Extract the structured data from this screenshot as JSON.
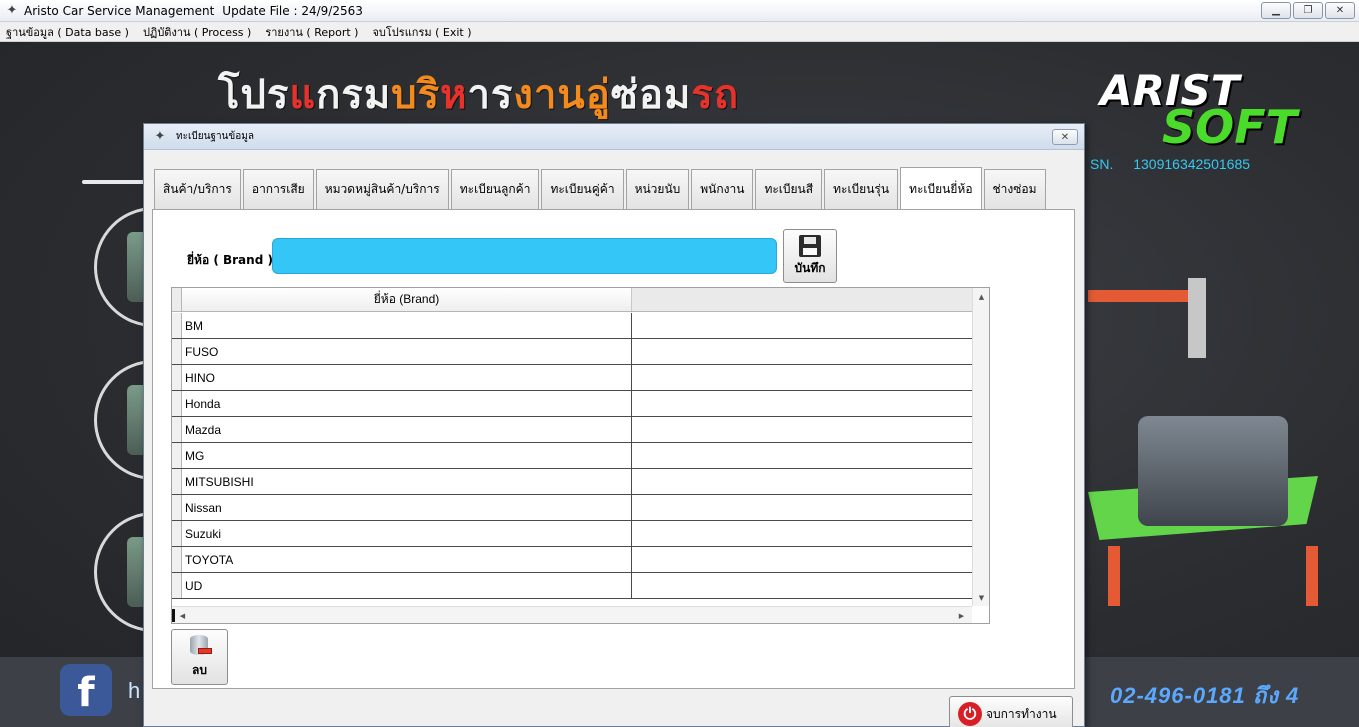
{
  "window": {
    "title": "Aristo Car Service Management",
    "update_text": "Update File : 24/9/2563",
    "minimize": "▁",
    "maximize": "❐",
    "close": "✕"
  },
  "menu": {
    "items": [
      "ฐานข้อมูล ( Data base )",
      "ปฏิบัติงาน ( Process )",
      "รายงาน ( Report )",
      "จบโปรแกรม ( Exit )"
    ]
  },
  "background": {
    "headline": [
      {
        "text": "โปร",
        "color": "#f2f2f2"
      },
      {
        "text": "แ",
        "color": "#e5322b"
      },
      {
        "text": "กรม",
        "color": "#f2f2f2"
      },
      {
        "text": "บริ",
        "color": "#f28a1d"
      },
      {
        "text": "ห",
        "color": "#e5322b"
      },
      {
        "text": "าร",
        "color": "#f2f2f2"
      },
      {
        "text": "งาน",
        "color": "#f28a1d"
      },
      {
        "text": "อู่",
        "color": "#f28a1d"
      },
      {
        "text": "ซ่อม",
        "color": "#f2f2f2"
      },
      {
        "text": "รถ",
        "color": "#e5322b"
      }
    ],
    "logo_top": "ARIST",
    "logo_bottom": "SOFT",
    "sn_label": "SN.",
    "sn_value": "130916342501685",
    "facebook_letter": "f",
    "facebook_text": "h",
    "phone": "02-496-0181 ถึง 4",
    "colors": {
      "logo_green": "#4bdb2b",
      "sn_blue": "#36c8f0",
      "phone_blue": "#5aa9ff"
    }
  },
  "dialog": {
    "title": "ทะเบียนฐานข้อมูล",
    "close": "✕",
    "tabs": [
      "สินค้า/บริการ",
      "อาการเสีย",
      "หมวดหมู่สินค้า/บริการ",
      "ทะเบียนลูกค้า",
      "ทะเบียนคู่ค้า",
      "หน่วยนับ",
      "พนักงาน",
      "ทะเบียนสี",
      "ทะเบียนรุ่น",
      "ทะเบียนยี่ห้อ",
      "ช่างซ่อม"
    ],
    "active_tab": "ทะเบียนยี่ห้อ",
    "brand_label": "ยี่ห้อ ( Brand )",
    "brand_value": "",
    "save_label": "บันทึก",
    "grid": {
      "column_header": "ยี่ห้อ (Brand)",
      "rows": [
        "BM",
        "FUSO",
        "HINO",
        "Honda",
        "Mazda",
        "MG",
        "MITSUBISHI",
        "Nissan",
        "Suzuki",
        "TOYOTA",
        "UD"
      ]
    },
    "delete_label": "ลบ",
    "exit_label": "จบการทำงาน",
    "colors": {
      "input_bg": "#33c6f6",
      "exit_icon": "#d81f26",
      "delete_icon": "#e13a2b"
    }
  }
}
